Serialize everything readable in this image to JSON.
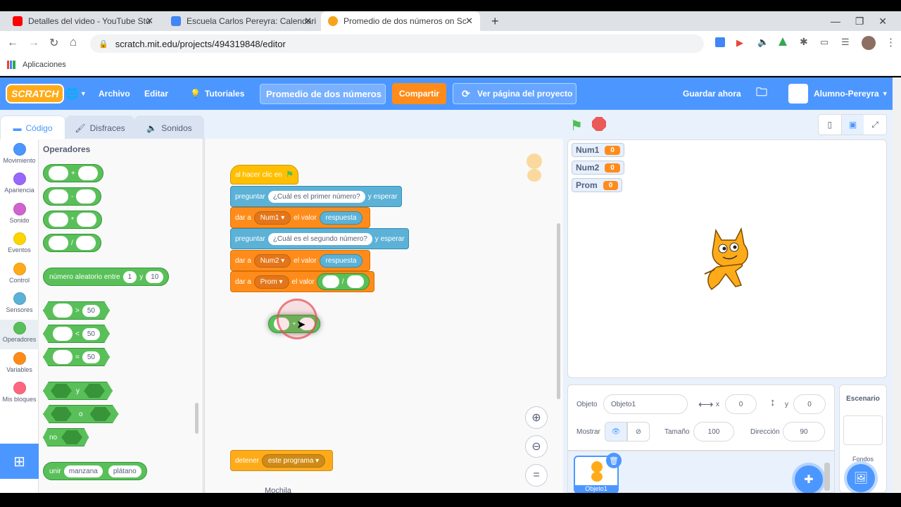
{
  "browser": {
    "tabs": [
      {
        "title": "Detalles del video - YouTube Stu",
        "favicon_color": "#ff0000"
      },
      {
        "title": "Escuela Carlos Pereyra: Calendari",
        "favicon_color": "#4285f4"
      },
      {
        "title": "Promedio de dos números on Sc",
        "favicon_color": "#f7a31c"
      }
    ],
    "url": "scratch.mit.edu/projects/494319848/editor",
    "bookmarks_label": "Aplicaciones"
  },
  "menubar": {
    "logo": "SCRATCH",
    "archivo": "Archivo",
    "editar": "Editar",
    "tutoriales": "Tutoriales",
    "project_title": "Promedio de dos números",
    "share": "Compartir",
    "see_project": "Ver página del proyecto",
    "save_now": "Guardar ahora",
    "username": "Alumno-Pereyra"
  },
  "editor_tabs": {
    "code": "Código",
    "costumes": "Disfraces",
    "sounds": "Sonidos"
  },
  "categories": [
    {
      "label": "Movimiento",
      "color": "#4c97ff"
    },
    {
      "label": "Apariencia",
      "color": "#9966ff"
    },
    {
      "label": "Sonido",
      "color": "#cf63cf"
    },
    {
      "label": "Eventos",
      "color": "#ffd500"
    },
    {
      "label": "Control",
      "color": "#ffab19"
    },
    {
      "label": "Sensores",
      "color": "#5cb1d6"
    },
    {
      "label": "Operadores",
      "color": "#59c059"
    },
    {
      "label": "Variables",
      "color": "#ff8c1a"
    },
    {
      "label": "Mis bloques",
      "color": "#ff6680"
    }
  ],
  "palette": {
    "heading": "Operadores",
    "plus": "+",
    "minus": "-",
    "times": "*",
    "divide": "/",
    "random_label": "número aleatorio entre",
    "random_from": "1",
    "random_and": "y",
    "random_to": "10",
    "gt": ">",
    "lt": "<",
    "eq": "=",
    "cmp_value": "50",
    "and": "y",
    "or": "o",
    "not": "no",
    "join": "unir",
    "join_a": "manzana",
    "join_b": "plátano"
  },
  "script": {
    "hat": "al hacer clic en",
    "ask1_pre": "preguntar",
    "ask1_q": "¿Cuál es el primer número?",
    "ask_post": "y esperar",
    "set_pre": "dar a",
    "var1": "Num1",
    "set_mid": "el valor",
    "answer": "respuesta",
    "ask2_q": "¿Cuál es el segundo número?",
    "var2": "Num2",
    "var3": "Prom",
    "div": "/",
    "drag_op": "+",
    "stop": "detener",
    "stop_opt": "este programa",
    "backpack": "Mochila"
  },
  "monitors": [
    {
      "name": "Num1",
      "value": "0"
    },
    {
      "name": "Num2",
      "value": "0"
    },
    {
      "name": "Prom",
      "value": "0"
    }
  ],
  "sprite_info": {
    "sprite_label": "Objeto",
    "sprite_name": "Objeto1",
    "x_label": "x",
    "x_value": "0",
    "y_label": "y",
    "y_value": "0",
    "show_label": "Mostrar",
    "size_label": "Tamaño",
    "size_value": "100",
    "direction_label": "Dirección",
    "direction_value": "90",
    "thumb_name": "Objeto1"
  },
  "stage_target": {
    "title": "Escenario",
    "backdrops": "Fondos"
  }
}
